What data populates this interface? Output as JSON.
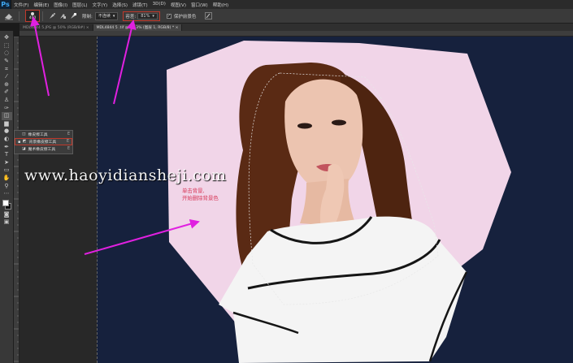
{
  "app": {
    "logo": "Ps",
    "menu": [
      "文件(F)",
      "编辑(E)",
      "图像(I)",
      "图层(L)",
      "文字(Y)",
      "选择(S)",
      "滤镜(T)",
      "3D(D)",
      "视图(V)",
      "窗口(W)",
      "帮助(H)"
    ]
  },
  "options_bar": {
    "tool_icon": "background-eraser-icon",
    "brush_size": "400",
    "limits_label": "限制:",
    "limits_value": "不连续",
    "tolerance_label": "容差:",
    "tolerance_value": "81%",
    "protect_fg_label": "保护前景色",
    "protect_fg_checked": true
  },
  "tabs": [
    {
      "label": "MDL4844 5.JPG @ 50% (RGB/8#) ×",
      "active": false
    },
    {
      "label": "MDL4844 5 .tif @ 33.3% (图层 1, RGB/8) * ×",
      "active": true
    }
  ],
  "toolbar": {
    "tools": [
      "move-icon",
      "marquee-icon",
      "lasso-icon",
      "quick-select-icon",
      "crop-icon",
      "eyedropper-icon",
      "healing-icon",
      "brush-icon",
      "stamp-icon",
      "history-brush-icon",
      "eraser-icon",
      "gradient-icon",
      "blur-icon",
      "dodge-icon",
      "pen-icon",
      "type-icon",
      "path-select-icon",
      "shape-icon",
      "hand-icon",
      "zoom-icon"
    ],
    "active_tool": "eraser-icon",
    "foreground_color": "#ffffff",
    "background_color": "#111111"
  },
  "flyout": {
    "items": [
      {
        "label": "橡皮擦工具",
        "key": "E",
        "selected": false
      },
      {
        "label": "背景橡皮擦工具",
        "key": "E",
        "selected": true
      },
      {
        "label": "魔术橡皮擦工具",
        "key": "E",
        "selected": false
      }
    ]
  },
  "canvas": {
    "background_color": "#16213d",
    "erase_area_color": "#f1d5e8"
  },
  "watermark": "www.haoyidiansheji.com",
  "annotation": "单击背景,\n开始删除背景色",
  "accent_color": "#e020e0"
}
